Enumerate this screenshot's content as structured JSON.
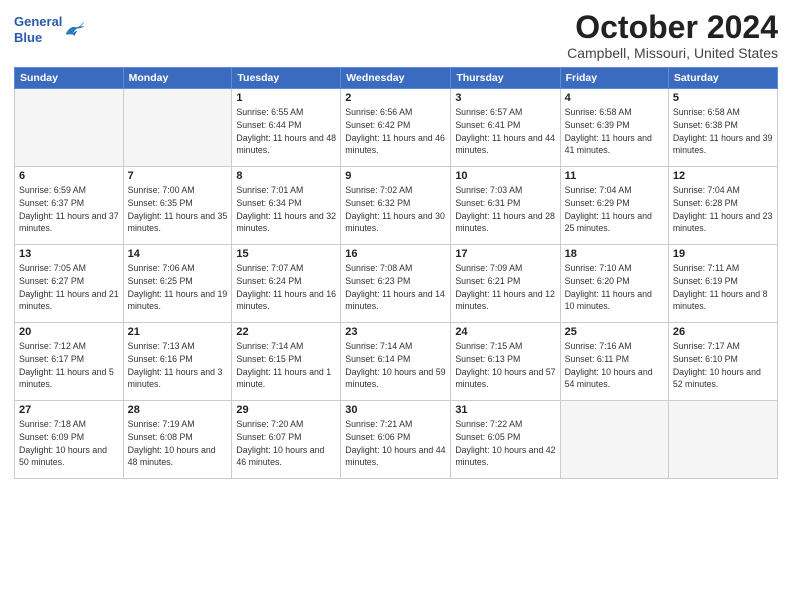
{
  "header": {
    "logo_line1": "General",
    "logo_line2": "Blue",
    "month": "October 2024",
    "location": "Campbell, Missouri, United States"
  },
  "weekdays": [
    "Sunday",
    "Monday",
    "Tuesday",
    "Wednesday",
    "Thursday",
    "Friday",
    "Saturday"
  ],
  "weeks": [
    [
      {
        "day": "",
        "info": ""
      },
      {
        "day": "",
        "info": ""
      },
      {
        "day": "1",
        "info": "Sunrise: 6:55 AM\nSunset: 6:44 PM\nDaylight: 11 hours and 48 minutes."
      },
      {
        "day": "2",
        "info": "Sunrise: 6:56 AM\nSunset: 6:42 PM\nDaylight: 11 hours and 46 minutes."
      },
      {
        "day": "3",
        "info": "Sunrise: 6:57 AM\nSunset: 6:41 PM\nDaylight: 11 hours and 44 minutes."
      },
      {
        "day": "4",
        "info": "Sunrise: 6:58 AM\nSunset: 6:39 PM\nDaylight: 11 hours and 41 minutes."
      },
      {
        "day": "5",
        "info": "Sunrise: 6:58 AM\nSunset: 6:38 PM\nDaylight: 11 hours and 39 minutes."
      }
    ],
    [
      {
        "day": "6",
        "info": "Sunrise: 6:59 AM\nSunset: 6:37 PM\nDaylight: 11 hours and 37 minutes."
      },
      {
        "day": "7",
        "info": "Sunrise: 7:00 AM\nSunset: 6:35 PM\nDaylight: 11 hours and 35 minutes."
      },
      {
        "day": "8",
        "info": "Sunrise: 7:01 AM\nSunset: 6:34 PM\nDaylight: 11 hours and 32 minutes."
      },
      {
        "day": "9",
        "info": "Sunrise: 7:02 AM\nSunset: 6:32 PM\nDaylight: 11 hours and 30 minutes."
      },
      {
        "day": "10",
        "info": "Sunrise: 7:03 AM\nSunset: 6:31 PM\nDaylight: 11 hours and 28 minutes."
      },
      {
        "day": "11",
        "info": "Sunrise: 7:04 AM\nSunset: 6:29 PM\nDaylight: 11 hours and 25 minutes."
      },
      {
        "day": "12",
        "info": "Sunrise: 7:04 AM\nSunset: 6:28 PM\nDaylight: 11 hours and 23 minutes."
      }
    ],
    [
      {
        "day": "13",
        "info": "Sunrise: 7:05 AM\nSunset: 6:27 PM\nDaylight: 11 hours and 21 minutes."
      },
      {
        "day": "14",
        "info": "Sunrise: 7:06 AM\nSunset: 6:25 PM\nDaylight: 11 hours and 19 minutes."
      },
      {
        "day": "15",
        "info": "Sunrise: 7:07 AM\nSunset: 6:24 PM\nDaylight: 11 hours and 16 minutes."
      },
      {
        "day": "16",
        "info": "Sunrise: 7:08 AM\nSunset: 6:23 PM\nDaylight: 11 hours and 14 minutes."
      },
      {
        "day": "17",
        "info": "Sunrise: 7:09 AM\nSunset: 6:21 PM\nDaylight: 11 hours and 12 minutes."
      },
      {
        "day": "18",
        "info": "Sunrise: 7:10 AM\nSunset: 6:20 PM\nDaylight: 11 hours and 10 minutes."
      },
      {
        "day": "19",
        "info": "Sunrise: 7:11 AM\nSunset: 6:19 PM\nDaylight: 11 hours and 8 minutes."
      }
    ],
    [
      {
        "day": "20",
        "info": "Sunrise: 7:12 AM\nSunset: 6:17 PM\nDaylight: 11 hours and 5 minutes."
      },
      {
        "day": "21",
        "info": "Sunrise: 7:13 AM\nSunset: 6:16 PM\nDaylight: 11 hours and 3 minutes."
      },
      {
        "day": "22",
        "info": "Sunrise: 7:14 AM\nSunset: 6:15 PM\nDaylight: 11 hours and 1 minute."
      },
      {
        "day": "23",
        "info": "Sunrise: 7:14 AM\nSunset: 6:14 PM\nDaylight: 10 hours and 59 minutes."
      },
      {
        "day": "24",
        "info": "Sunrise: 7:15 AM\nSunset: 6:13 PM\nDaylight: 10 hours and 57 minutes."
      },
      {
        "day": "25",
        "info": "Sunrise: 7:16 AM\nSunset: 6:11 PM\nDaylight: 10 hours and 54 minutes."
      },
      {
        "day": "26",
        "info": "Sunrise: 7:17 AM\nSunset: 6:10 PM\nDaylight: 10 hours and 52 minutes."
      }
    ],
    [
      {
        "day": "27",
        "info": "Sunrise: 7:18 AM\nSunset: 6:09 PM\nDaylight: 10 hours and 50 minutes."
      },
      {
        "day": "28",
        "info": "Sunrise: 7:19 AM\nSunset: 6:08 PM\nDaylight: 10 hours and 48 minutes."
      },
      {
        "day": "29",
        "info": "Sunrise: 7:20 AM\nSunset: 6:07 PM\nDaylight: 10 hours and 46 minutes."
      },
      {
        "day": "30",
        "info": "Sunrise: 7:21 AM\nSunset: 6:06 PM\nDaylight: 10 hours and 44 minutes."
      },
      {
        "day": "31",
        "info": "Sunrise: 7:22 AM\nSunset: 6:05 PM\nDaylight: 10 hours and 42 minutes."
      },
      {
        "day": "",
        "info": ""
      },
      {
        "day": "",
        "info": ""
      }
    ]
  ]
}
